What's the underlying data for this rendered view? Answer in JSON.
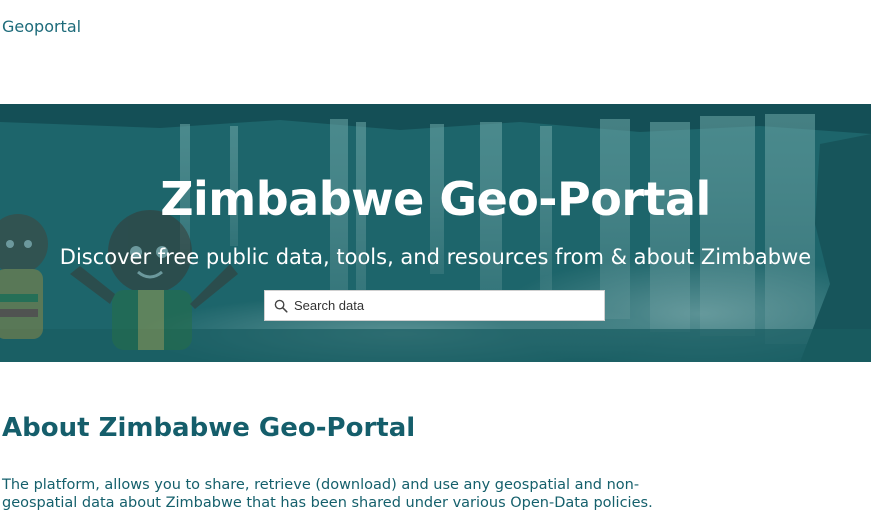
{
  "header": {
    "brand": "Geoportal"
  },
  "hero": {
    "title": "Zimbabwe Geo-Portal",
    "subtitle": "Discover free public data, tools, and resources from & about Zimbabwe",
    "search": {
      "placeholder": "Search data",
      "value": "",
      "icon": "search-icon"
    }
  },
  "about": {
    "title": "About Zimbabwe Geo-Portal",
    "body_line1": "The platform, allows you to share, retrieve (download) and use any geospatial and non-",
    "body_line2": "geospatial data about Zimbabwe that has been shared under various Open-Data policies."
  },
  "colors": {
    "accent": "#1d6b7a",
    "hero_overlay": "#2a7a7e"
  }
}
